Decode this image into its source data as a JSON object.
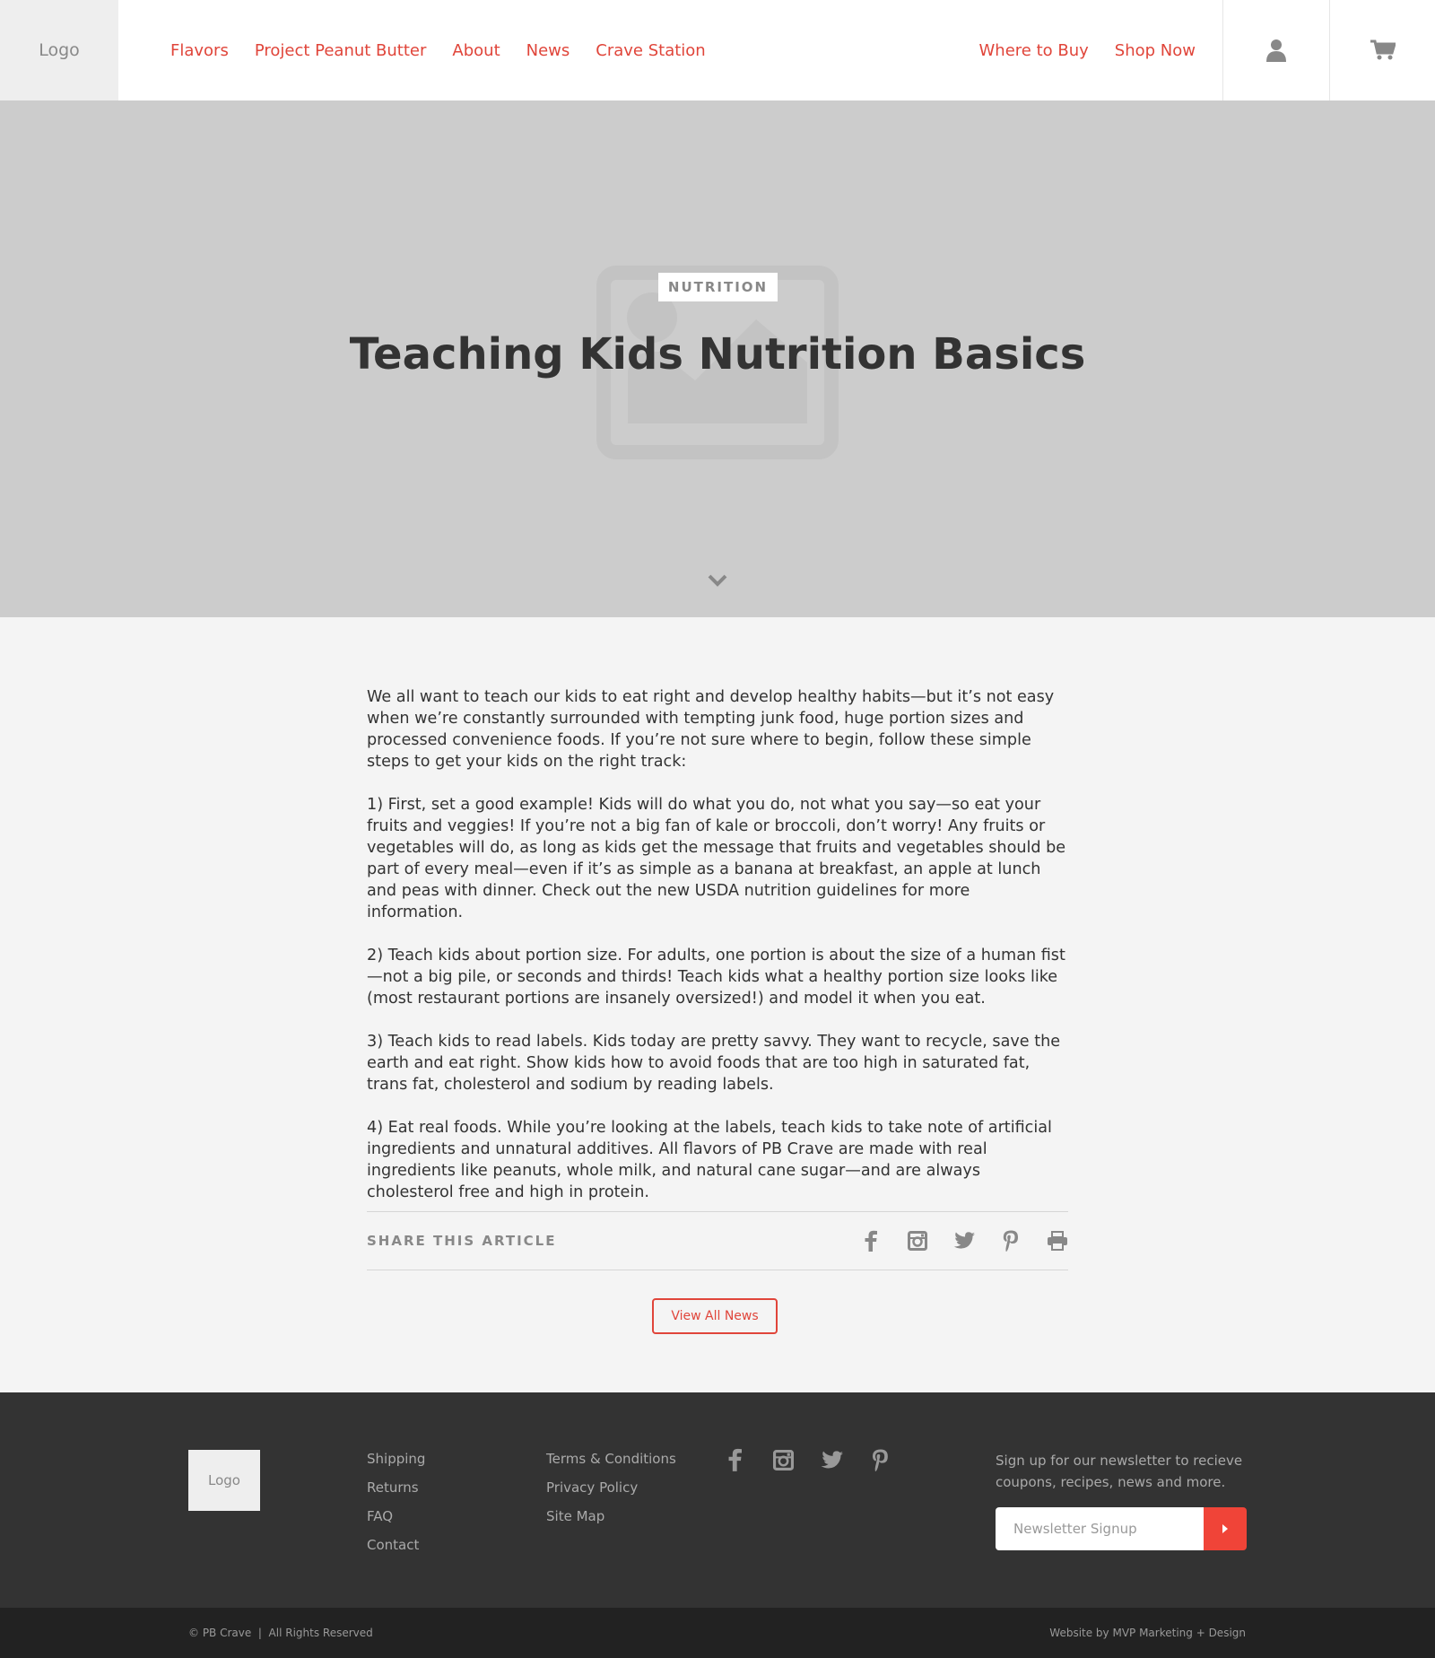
{
  "header": {
    "logo": "Logo",
    "nav": [
      "Flavors",
      "Project Peanut Butter",
      "About",
      "News",
      "Crave Station"
    ],
    "nav_right": [
      "Where to Buy",
      "Shop Now"
    ],
    "icons": [
      "user-icon",
      "cart-icon"
    ]
  },
  "hero": {
    "category": "NUTRITION",
    "title": "Teaching Kids Nutrition Basics",
    "image_icon": "image-placeholder-icon",
    "scroll_icon": "chevron-down-icon"
  },
  "article": {
    "paragraphs": [
      "We all want to teach our kids to eat right and develop healthy habits—but it’s not easy when we’re constantly surrounded with tempting junk food, huge portion sizes and processed convenience foods. If you’re not sure where to begin, follow these simple steps to get your kids on the right track:",
      "1) First, set a good example! Kids will do what you do, not what you say—so eat your fruits and veggies! If you’re not a big fan of kale or broccoli, don’t worry! Any fruits or vegetables will do, as long as kids get the message that fruits and vegetables should be part of every meal—even if it’s as simple as a banana at breakfast, an apple at lunch and peas with dinner. Check out the new USDA nutrition guidelines for more information.",
      "2) Teach kids about portion size. For adults, one portion is about the size of a human fist—not a big pile, or seconds and thirds!  Teach kids what a healthy portion size looks like (most restaurant portions are insanely oversized!) and model it when you eat.",
      "3) Teach kids to read labels. Kids today are pretty savvy. They want to recycle, save the earth and eat right.  Show kids how to avoid foods that are too high in saturated fat, trans fat, cholesterol and sodium by reading labels.",
      "4) Eat real foods. While you’re looking at the labels, teach kids to take note of artificial ingredients and unnatural additives. All flavors of PB Crave are made with real ingredients like peanuts, whole milk, and natural cane sugar—and are always cholesterol free and high in protein."
    ],
    "share_label": "SHARE THIS ARTICLE",
    "share_icons": [
      "facebook-icon",
      "instagram-icon",
      "twitter-icon",
      "pinterest-icon",
      "print-icon"
    ],
    "view_all": "View All News"
  },
  "footer": {
    "logo": "Logo",
    "col1": [
      "Shipping",
      "Returns",
      "FAQ",
      "Contact"
    ],
    "col2": [
      "Terms & Conditions",
      "Privacy Policy",
      "Site Map"
    ],
    "social_icons": [
      "facebook-icon",
      "instagram-icon",
      "twitter-icon",
      "pinterest-icon"
    ],
    "newsletter_text": "Sign up for our newsletter to recieve coupons, recipes, news and more.",
    "newsletter_placeholder": "Newsletter Signup",
    "copyright": "© PB Crave  |  All Rights Reserved",
    "credit": "Website by MVP Marketing + Design"
  },
  "colors": {
    "accent": "#e0453a",
    "submit": "#f04438",
    "footer_bg": "#333333",
    "bottom_bar": "#222222",
    "hero_bg": "#cccccc"
  }
}
